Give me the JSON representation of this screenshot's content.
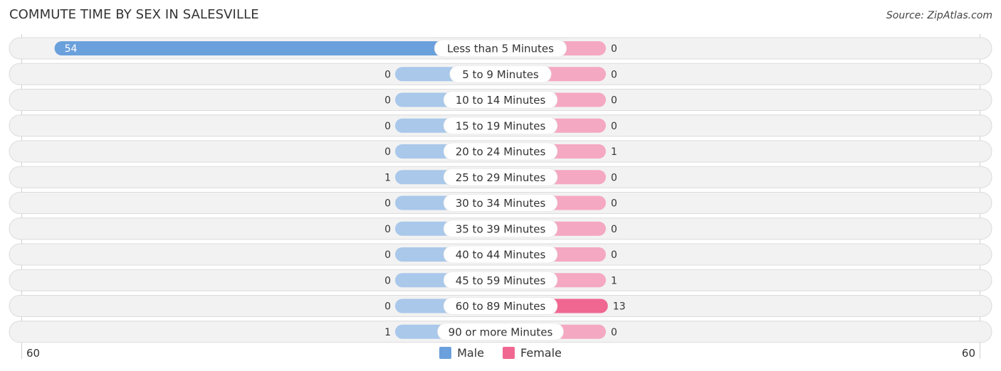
{
  "title": "COMMUTE TIME BY SEX IN SALESVILLE",
  "source": "Source: ZipAtlas.com",
  "colors": {
    "male_strong": "#6aa0dc",
    "male_light": "#a9c8ea",
    "female_strong": "#f06792",
    "female_light": "#f5a8c1",
    "row_bg": "#f2f2f2",
    "row_border": "#dcdcdc"
  },
  "chart_data": {
    "type": "bar",
    "orientation": "horizontal-diverging",
    "title": "COMMUTE TIME BY SEX IN SALESVILLE",
    "categories": [
      "Less than 5 Minutes",
      "5 to 9 Minutes",
      "10 to 14 Minutes",
      "15 to 19 Minutes",
      "20 to 24 Minutes",
      "25 to 29 Minutes",
      "30 to 34 Minutes",
      "35 to 39 Minutes",
      "40 to 44 Minutes",
      "45 to 59 Minutes",
      "60 to 89 Minutes",
      "90 or more Minutes"
    ],
    "series": [
      {
        "name": "Male",
        "side": "left",
        "values": [
          54,
          0,
          0,
          0,
          0,
          1,
          0,
          0,
          0,
          0,
          0,
          1
        ]
      },
      {
        "name": "Female",
        "side": "right",
        "values": [
          0,
          0,
          0,
          0,
          1,
          0,
          0,
          0,
          0,
          1,
          13,
          0
        ]
      }
    ],
    "axis": {
      "min_label": "60",
      "max_label": "60",
      "range": [
        -60,
        60
      ]
    },
    "legend": {
      "position": "bottom-center",
      "entries": [
        "Male",
        "Female"
      ]
    },
    "grid": false
  }
}
